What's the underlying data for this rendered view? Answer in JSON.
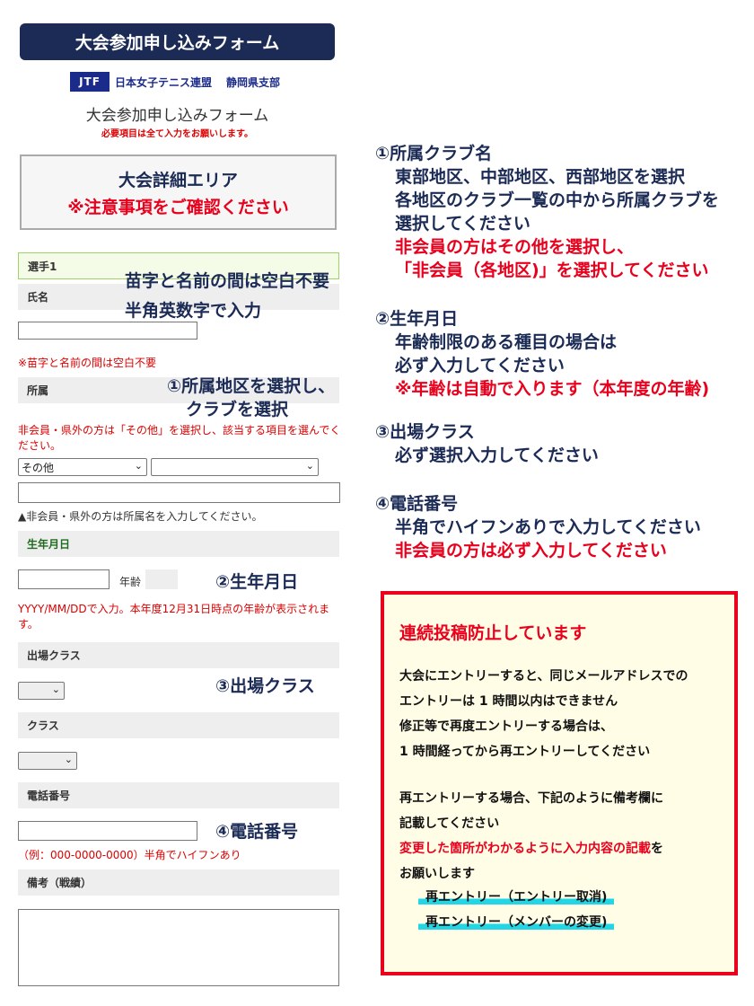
{
  "header": {
    "title": "大会参加申し込みフォーム"
  },
  "logo": {
    "mark": "JTF",
    "org_name": "日本女子テニス連盟",
    "branch": "静岡県支部"
  },
  "form": {
    "title": "大会参加申し込みフォーム",
    "required_note": "必要項目は全て入力をお願いします。",
    "detail_box": {
      "title": "大会詳細エリア",
      "warning": "※注意事項をご確認ください"
    },
    "player_header": "選手1",
    "name": {
      "label": "氏名",
      "value": "",
      "note": "※苗字と名前の間は空白不要"
    },
    "affiliation": {
      "label": "所属",
      "note": "非会員・県外の方は「その他」を選択し、該当する項目を選んでください。",
      "region_select": "その他",
      "club_select": "",
      "free_text": "",
      "free_note": "▲非会員・県外の方は所属名を入力してください。"
    },
    "birthdate": {
      "label": "生年月日",
      "value": "",
      "age_label": "年齢",
      "age_value": "",
      "note": "YYYY/MM/DDで入力。本年度12月31日時点の年齢が表示されます。"
    },
    "entry_class": {
      "label": "出場クラス",
      "value": ""
    },
    "class": {
      "label": "クラス",
      "value": ""
    },
    "phone": {
      "label": "電話番号",
      "value": "",
      "note": "（例：000-0000-0000）半角でハイフンあり"
    },
    "remarks": {
      "label": "備考（戦績）",
      "value": ""
    }
  },
  "overlays": {
    "name_hint_1": "苗字と名前の間は空白不要",
    "name_hint_2": "半角英数字で入力",
    "region_hint_1": "①所属地区を選択し、",
    "region_hint_2": "クラブを選択",
    "birth_hint": "②生年月日",
    "class_hint": "③出場クラス",
    "phone_hint": "④電話番号"
  },
  "instructions": {
    "club": {
      "heading": "①所属クラブ名",
      "lines": [
        "東部地区、中部地区、西部地区を選択",
        "各地区のクラブ一覧の中から所属クラブを",
        "選択してください"
      ],
      "red_lines": [
        "非会員の方はその他を選択し、",
        "「非会員（各地区)」を選択してください"
      ]
    },
    "birth": {
      "heading": "②生年月日",
      "lines": [
        "年齢制限のある種目の場合は",
        "必ず入力してください"
      ],
      "red_line": "※年齢は自動で入ります（本年度の年齢)"
    },
    "class": {
      "heading": "③出場クラス",
      "line": "必ず選択入力してください"
    },
    "phone": {
      "heading": "④電話番号",
      "line": "半角でハイフンありで入力してください",
      "red_line": "非会員の方は必ず入力してください"
    }
  },
  "notice": {
    "title": "連続投稿防止しています",
    "p1": [
      "大会にエントリーすると、同じメールアドレスでの",
      "エントリーは 1 時間以内はできません",
      "修正等で再度エントリーする場合は、",
      "1 時間経ってから再エントリーしてください"
    ],
    "p2_line1": "再エントリーする場合、下記のように備考欄に",
    "p2_line2": "記載してください",
    "p2_red": "変更した箇所がわかるように入力内容の記載",
    "p2_red_suffix": "を",
    "p2_line4": "お願いします",
    "example1": "再エントリー（エントリー取消)",
    "example2": "再エントリー（メンバーの変更)"
  },
  "colors": {
    "header_bg": "#1b2b55",
    "accent_red": "#e8001c",
    "notice_bg": "#fffde6",
    "highlight": "#22d6e6"
  }
}
